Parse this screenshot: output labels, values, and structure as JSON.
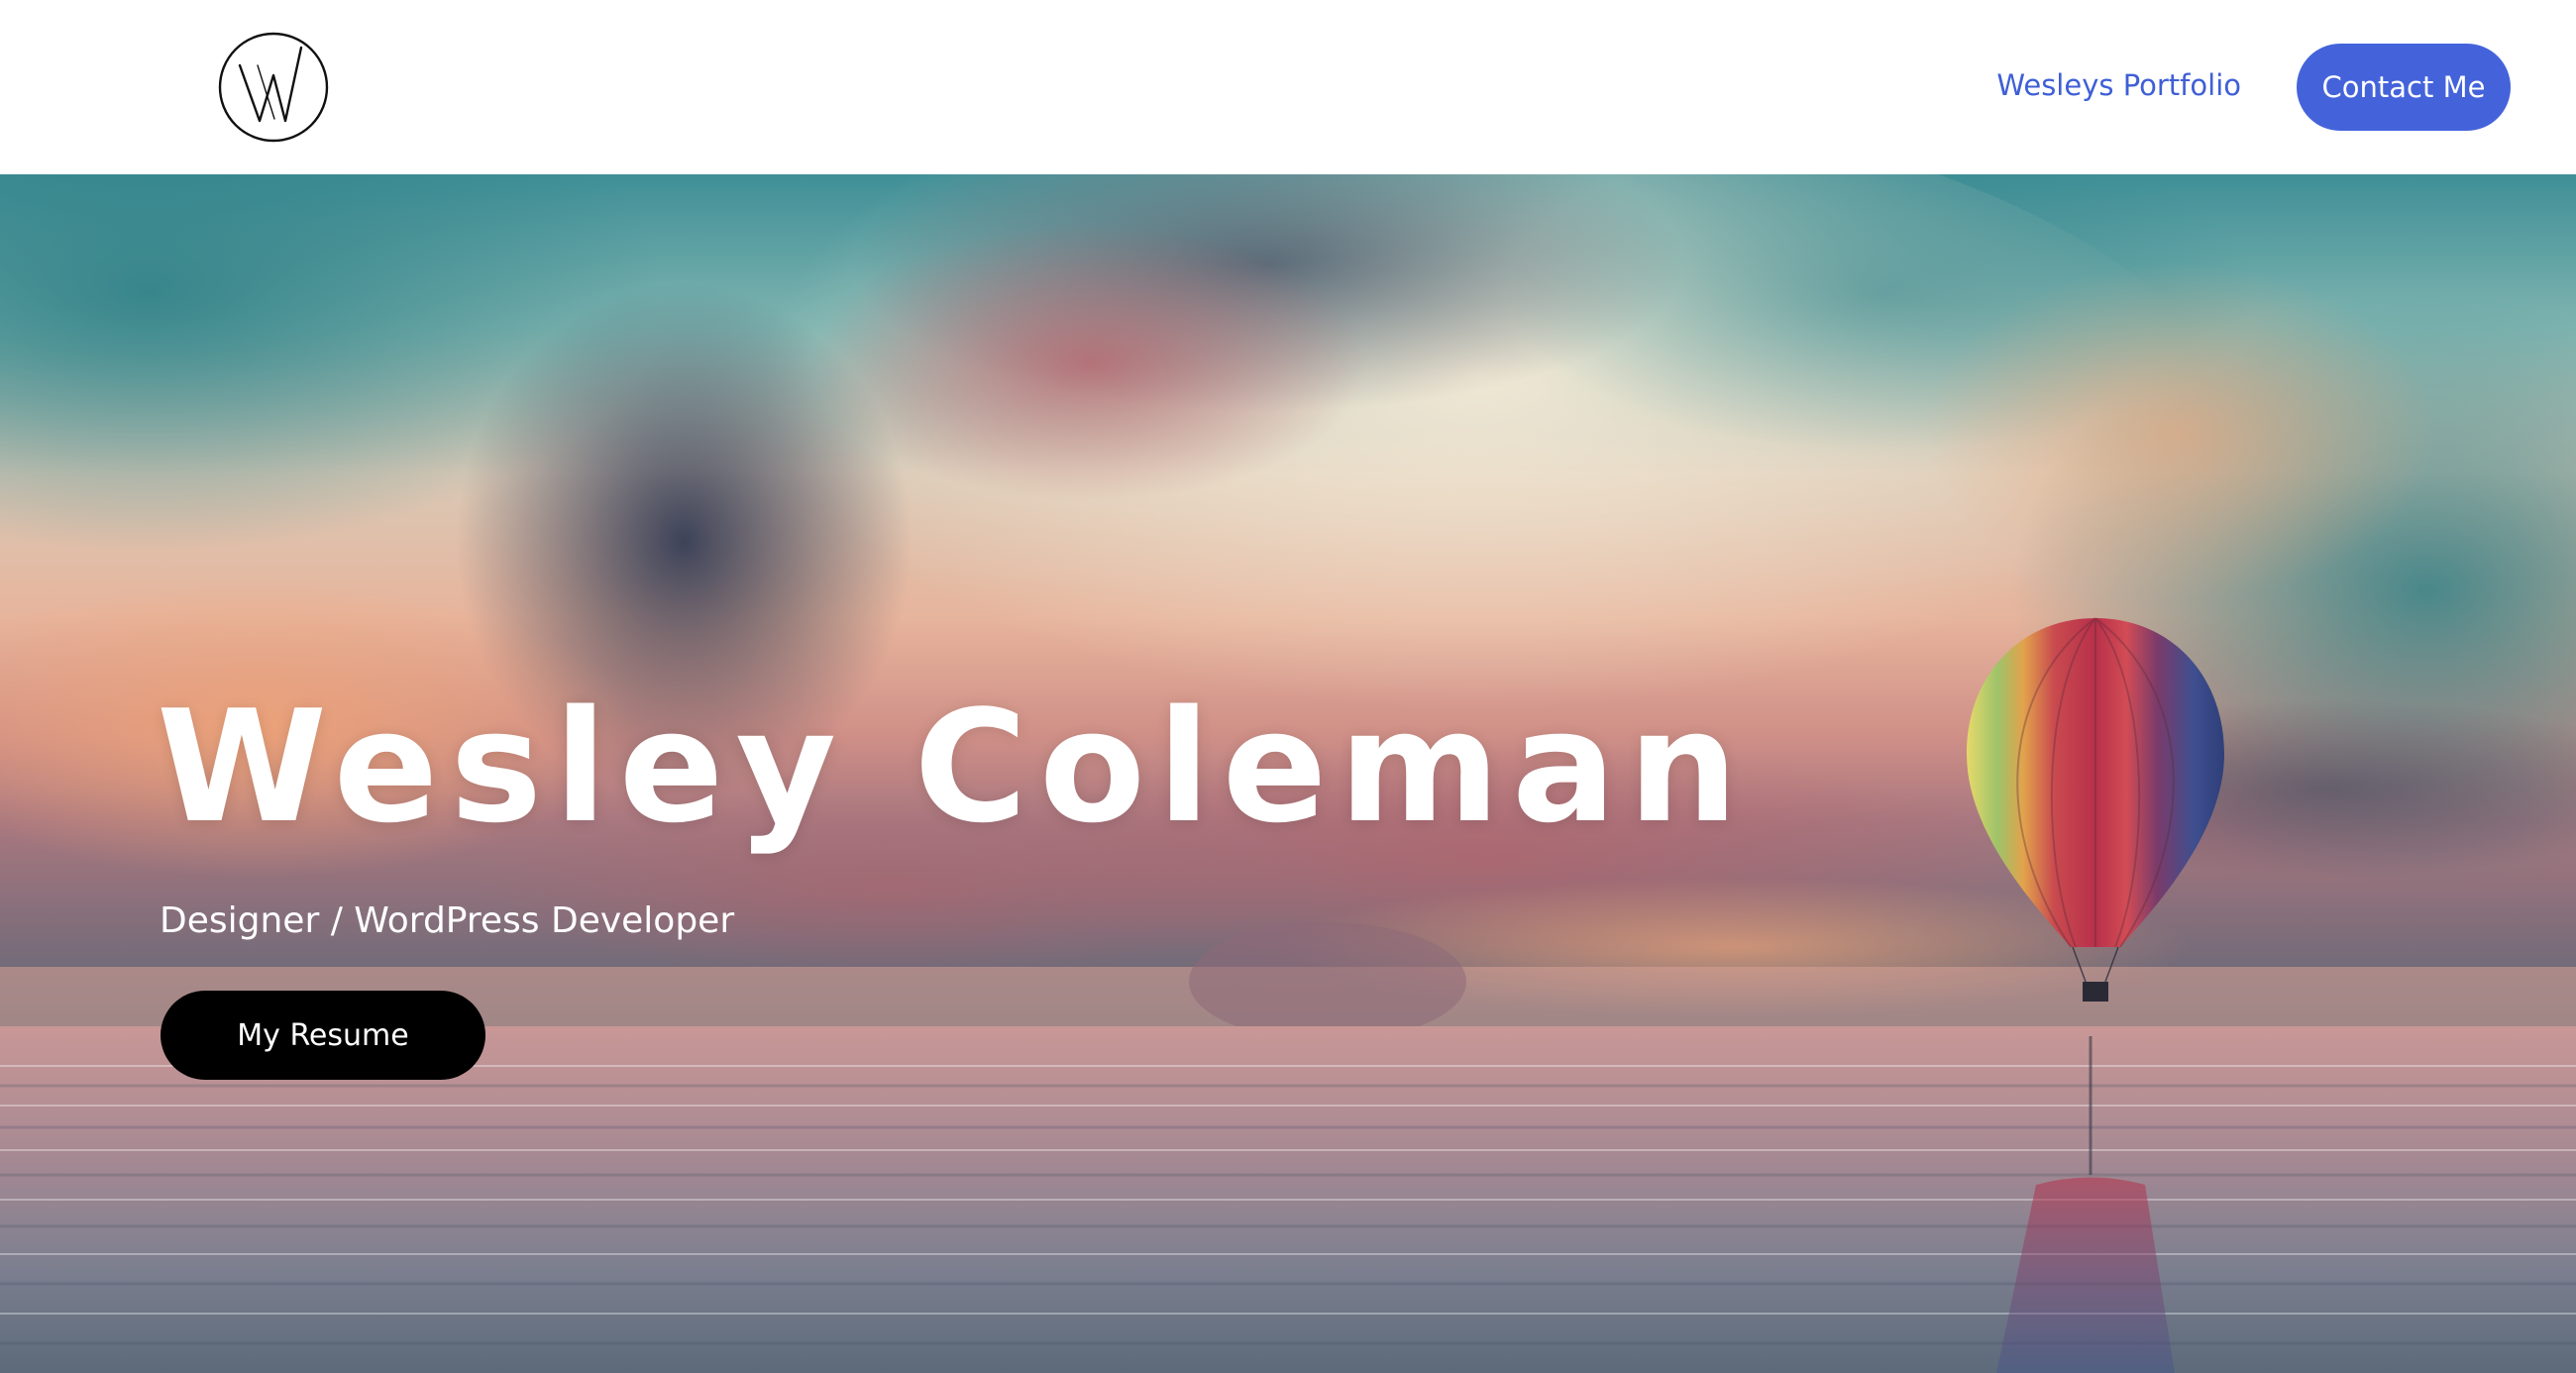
{
  "header": {
    "logo_icon": "w-circle-logo-icon",
    "nav_link_label": "Wesleys Portfolio",
    "contact_button_label": "Contact Me"
  },
  "hero": {
    "title": "Wesley Coleman",
    "subtitle": "Designer / WordPress Developer",
    "resume_button_label": "My Resume",
    "background_image": "sunset-sky-hot-air-balloon-over-water"
  },
  "colors": {
    "link": "#3f5fd6",
    "contact_button_bg": "#4463db",
    "resume_button_bg": "#000000",
    "header_bg": "#ffffff"
  }
}
